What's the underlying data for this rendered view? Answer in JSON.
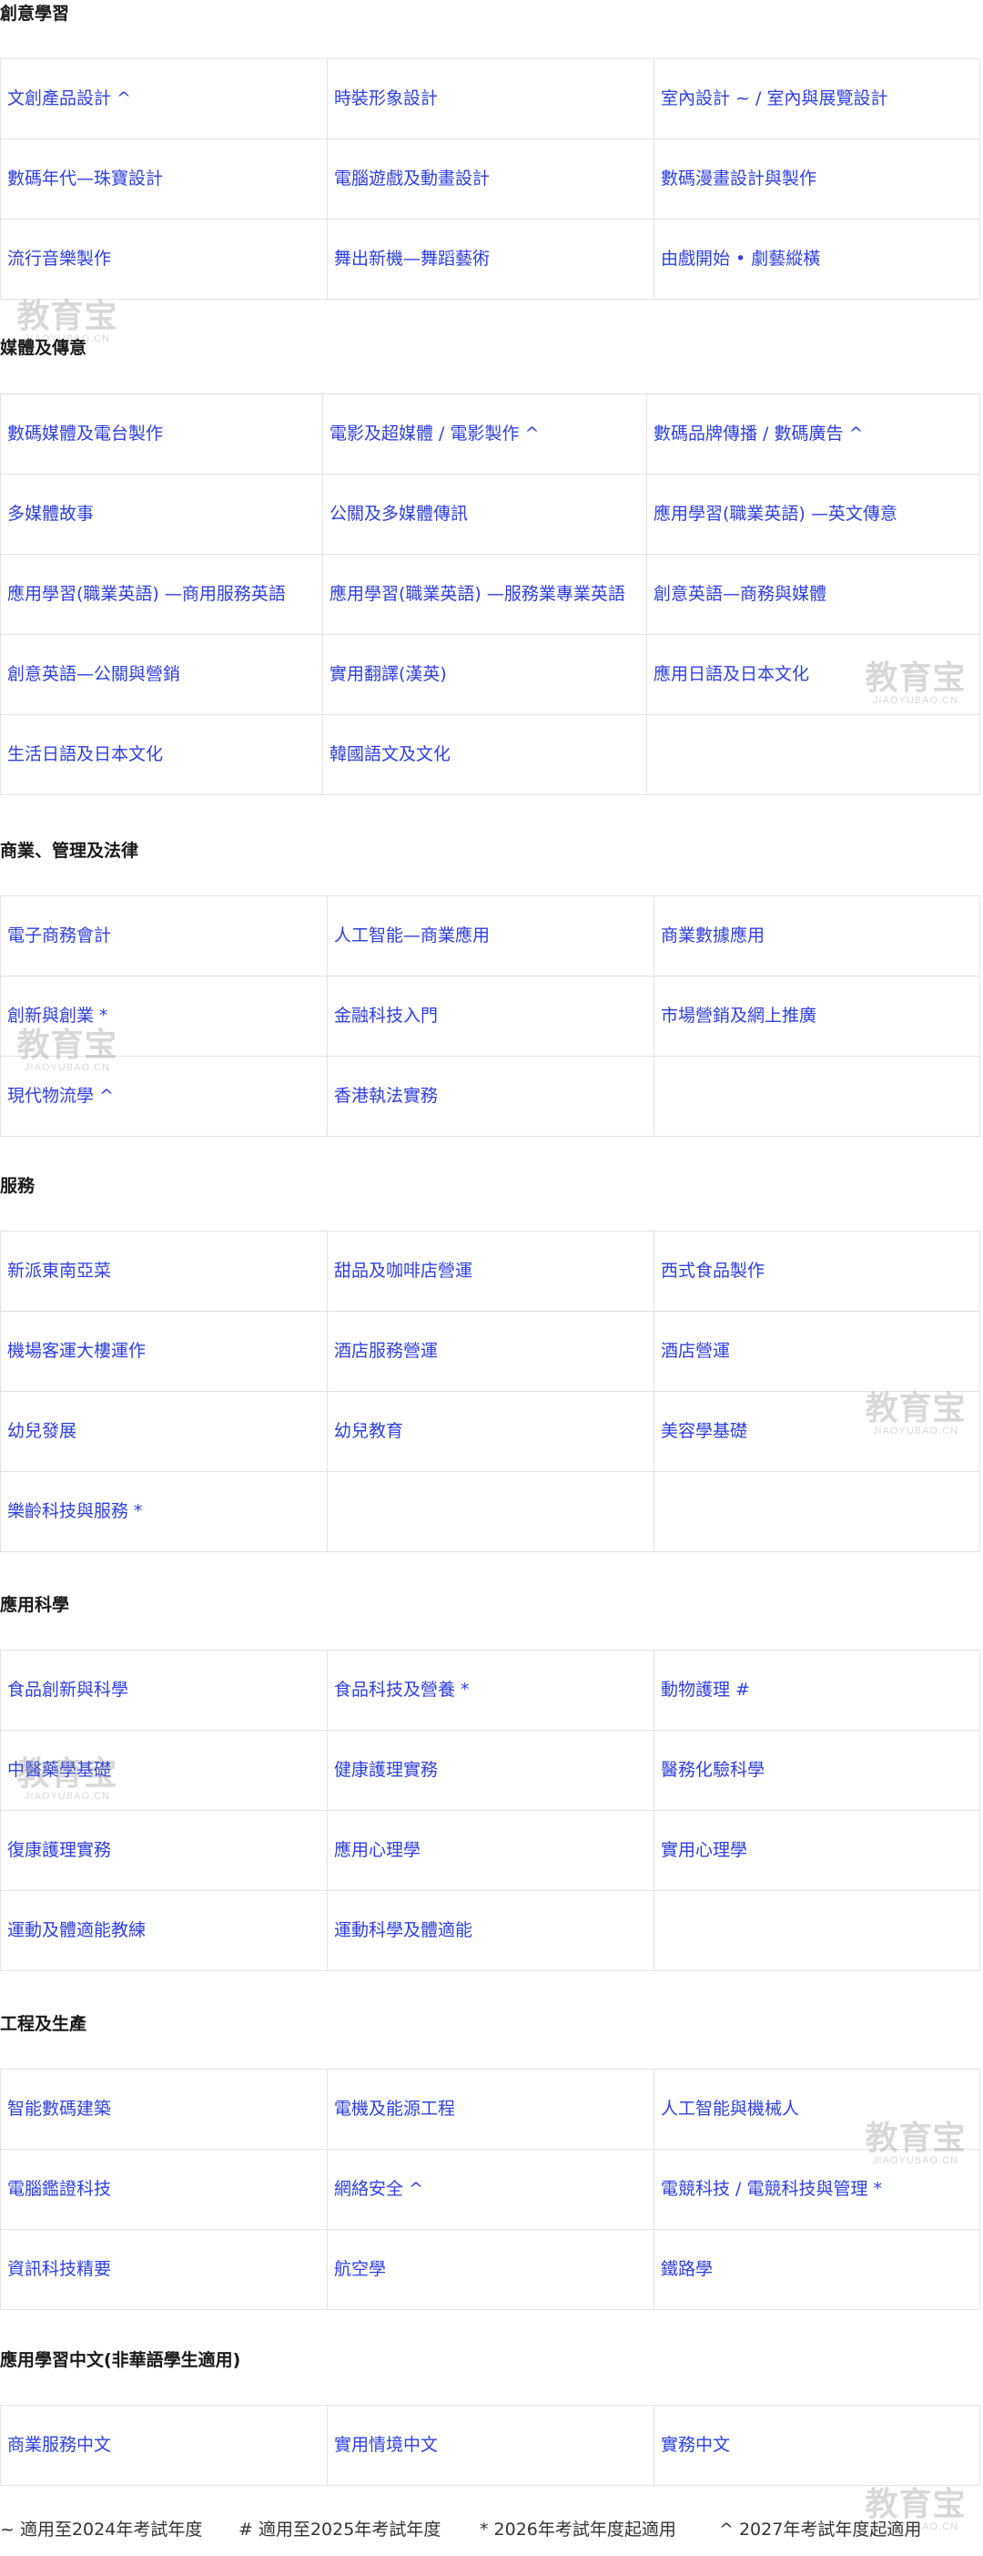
{
  "sections": [
    {
      "title": "創意學習",
      "rows": [
        [
          "文創產品設計 ^",
          "時裝形象設計",
          "室內設計 ~ / 室內與展覽設計"
        ],
        [
          "數碼年代—珠寶設計",
          "電腦遊戲及動畫設計",
          "數碼漫畫設計與製作"
        ],
        [
          "流行音樂製作",
          "舞出新機—舞蹈藝術",
          "由戲開始 • 劇藝縱橫"
        ]
      ]
    },
    {
      "title": "媒體及傳意",
      "rows": [
        [
          "數碼媒體及電台製作",
          "電影及超媒體 / 電影製作 ^",
          "數碼品牌傳播 / 數碼廣告 ^"
        ],
        [
          "多媒體故事",
          "公關及多媒體傳訊",
          "應用學習(職業英語) —英文傳意"
        ],
        [
          "應用學習(職業英語) —商用服務英語",
          "應用學習(職業英語) —服務業專業英語",
          "創意英語—商務與媒體"
        ],
        [
          "創意英語—公關與營銷",
          "實用翻譯(漢英)",
          "應用日語及日本文化"
        ],
        [
          "生活日語及日本文化",
          "韓國語文及文化",
          ""
        ]
      ]
    },
    {
      "title": "商業、管理及法律",
      "rows": [
        [
          "電子商務會計",
          "人工智能—商業應用",
          "商業數據應用"
        ],
        [
          "創新與創業 *",
          "金融科技入門",
          "市場營銷及網上推廣"
        ],
        [
          "現代物流學 ^",
          "香港執法實務",
          ""
        ]
      ]
    },
    {
      "title": "服務",
      "rows": [
        [
          "新派東南亞菜",
          "甜品及咖啡店營運",
          "西式食品製作"
        ],
        [
          "機場客運大樓運作",
          "酒店服務營運",
          "酒店營運"
        ],
        [
          "幼兒發展",
          "幼兒教育",
          "美容學基礎"
        ],
        [
          "樂齡科技與服務 *",
          "",
          ""
        ]
      ]
    },
    {
      "title": "應用科學",
      "rows": [
        [
          "食品創新與科學",
          "食品科技及營養 *",
          "動物護理 #"
        ],
        [
          "中醫藥學基礎",
          "健康護理實務",
          "醫務化驗科學"
        ],
        [
          "復康護理實務",
          "應用心理學",
          "實用心理學"
        ],
        [
          "運動及體適能教練",
          "運動科學及體適能",
          ""
        ]
      ]
    },
    {
      "title": "工程及生產",
      "rows": [
        [
          "智能數碼建築",
          "電機及能源工程",
          "人工智能與機械人"
        ],
        [
          "電腦鑑證科技",
          "網絡安全 ^",
          "電競科技 / 電競科技與管理 *"
        ],
        [
          "資訊科技精要",
          "航空學",
          "鐵路學"
        ]
      ]
    },
    {
      "title": "應用學習中文(非華語學生適用)",
      "rows": [
        [
          "商業服務中文",
          "實用情境中文",
          "實務中文"
        ]
      ]
    }
  ],
  "footer": {
    "note_tilde": "~ 適用至2024年考試年度",
    "note_hash": "# 適用至2025年考試年度",
    "note_star": "* 2026年考試年度起適用",
    "note_caret": "^ 2027年考試年度起適用"
  },
  "watermark": {
    "cn": "教育宝",
    "en": "JIAOYUBAO.CN"
  },
  "colors": {
    "link": "#2d3fe0",
    "heading": "#1a1a1a",
    "border": "#e3e3e3"
  }
}
